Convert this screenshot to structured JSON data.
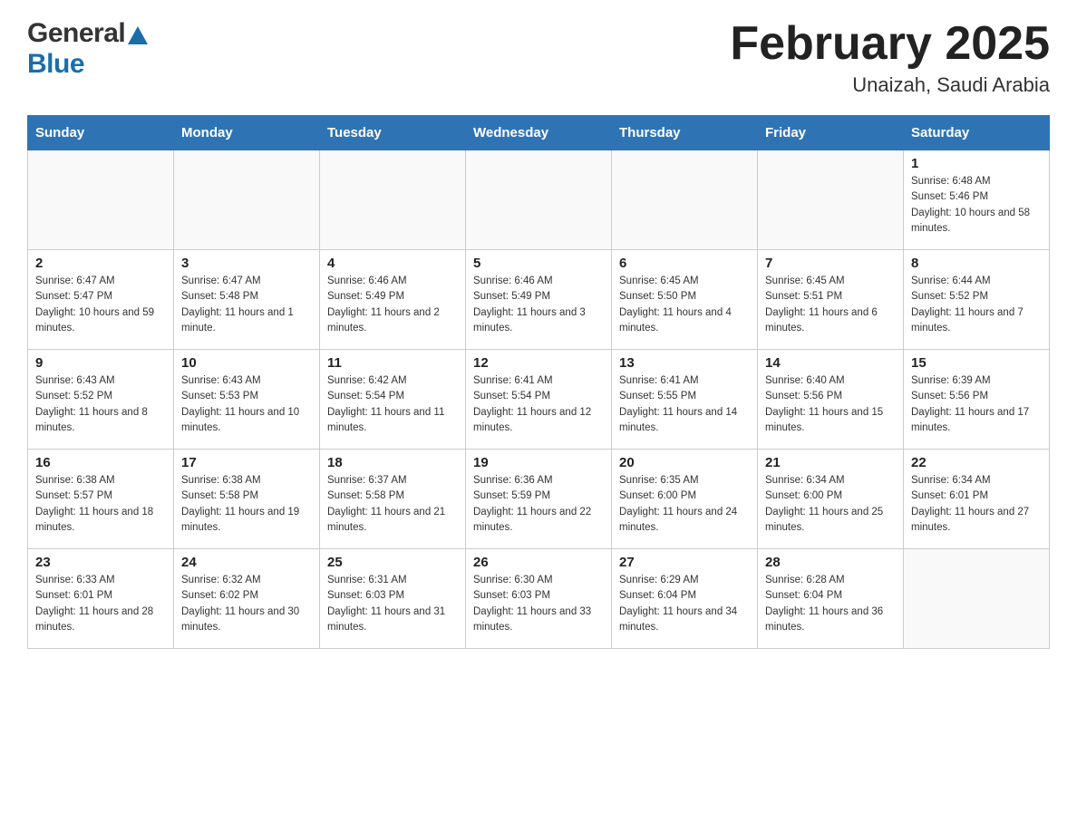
{
  "header": {
    "title": "February 2025",
    "subtitle": "Unaizah, Saudi Arabia",
    "logo_general": "General",
    "logo_blue": "Blue"
  },
  "days_of_week": [
    "Sunday",
    "Monday",
    "Tuesday",
    "Wednesday",
    "Thursday",
    "Friday",
    "Saturday"
  ],
  "weeks": [
    [
      {
        "day": "",
        "sunrise": "",
        "sunset": "",
        "daylight": "",
        "empty": true
      },
      {
        "day": "",
        "sunrise": "",
        "sunset": "",
        "daylight": "",
        "empty": true
      },
      {
        "day": "",
        "sunrise": "",
        "sunset": "",
        "daylight": "",
        "empty": true
      },
      {
        "day": "",
        "sunrise": "",
        "sunset": "",
        "daylight": "",
        "empty": true
      },
      {
        "day": "",
        "sunrise": "",
        "sunset": "",
        "daylight": "",
        "empty": true
      },
      {
        "day": "",
        "sunrise": "",
        "sunset": "",
        "daylight": "",
        "empty": true
      },
      {
        "day": "1",
        "sunrise": "Sunrise: 6:48 AM",
        "sunset": "Sunset: 5:46 PM",
        "daylight": "Daylight: 10 hours and 58 minutes.",
        "empty": false
      }
    ],
    [
      {
        "day": "2",
        "sunrise": "Sunrise: 6:47 AM",
        "sunset": "Sunset: 5:47 PM",
        "daylight": "Daylight: 10 hours and 59 minutes.",
        "empty": false
      },
      {
        "day": "3",
        "sunrise": "Sunrise: 6:47 AM",
        "sunset": "Sunset: 5:48 PM",
        "daylight": "Daylight: 11 hours and 1 minute.",
        "empty": false
      },
      {
        "day": "4",
        "sunrise": "Sunrise: 6:46 AM",
        "sunset": "Sunset: 5:49 PM",
        "daylight": "Daylight: 11 hours and 2 minutes.",
        "empty": false
      },
      {
        "day": "5",
        "sunrise": "Sunrise: 6:46 AM",
        "sunset": "Sunset: 5:49 PM",
        "daylight": "Daylight: 11 hours and 3 minutes.",
        "empty": false
      },
      {
        "day": "6",
        "sunrise": "Sunrise: 6:45 AM",
        "sunset": "Sunset: 5:50 PM",
        "daylight": "Daylight: 11 hours and 4 minutes.",
        "empty": false
      },
      {
        "day": "7",
        "sunrise": "Sunrise: 6:45 AM",
        "sunset": "Sunset: 5:51 PM",
        "daylight": "Daylight: 11 hours and 6 minutes.",
        "empty": false
      },
      {
        "day": "8",
        "sunrise": "Sunrise: 6:44 AM",
        "sunset": "Sunset: 5:52 PM",
        "daylight": "Daylight: 11 hours and 7 minutes.",
        "empty": false
      }
    ],
    [
      {
        "day": "9",
        "sunrise": "Sunrise: 6:43 AM",
        "sunset": "Sunset: 5:52 PM",
        "daylight": "Daylight: 11 hours and 8 minutes.",
        "empty": false
      },
      {
        "day": "10",
        "sunrise": "Sunrise: 6:43 AM",
        "sunset": "Sunset: 5:53 PM",
        "daylight": "Daylight: 11 hours and 10 minutes.",
        "empty": false
      },
      {
        "day": "11",
        "sunrise": "Sunrise: 6:42 AM",
        "sunset": "Sunset: 5:54 PM",
        "daylight": "Daylight: 11 hours and 11 minutes.",
        "empty": false
      },
      {
        "day": "12",
        "sunrise": "Sunrise: 6:41 AM",
        "sunset": "Sunset: 5:54 PM",
        "daylight": "Daylight: 11 hours and 12 minutes.",
        "empty": false
      },
      {
        "day": "13",
        "sunrise": "Sunrise: 6:41 AM",
        "sunset": "Sunset: 5:55 PM",
        "daylight": "Daylight: 11 hours and 14 minutes.",
        "empty": false
      },
      {
        "day": "14",
        "sunrise": "Sunrise: 6:40 AM",
        "sunset": "Sunset: 5:56 PM",
        "daylight": "Daylight: 11 hours and 15 minutes.",
        "empty": false
      },
      {
        "day": "15",
        "sunrise": "Sunrise: 6:39 AM",
        "sunset": "Sunset: 5:56 PM",
        "daylight": "Daylight: 11 hours and 17 minutes.",
        "empty": false
      }
    ],
    [
      {
        "day": "16",
        "sunrise": "Sunrise: 6:38 AM",
        "sunset": "Sunset: 5:57 PM",
        "daylight": "Daylight: 11 hours and 18 minutes.",
        "empty": false
      },
      {
        "day": "17",
        "sunrise": "Sunrise: 6:38 AM",
        "sunset": "Sunset: 5:58 PM",
        "daylight": "Daylight: 11 hours and 19 minutes.",
        "empty": false
      },
      {
        "day": "18",
        "sunrise": "Sunrise: 6:37 AM",
        "sunset": "Sunset: 5:58 PM",
        "daylight": "Daylight: 11 hours and 21 minutes.",
        "empty": false
      },
      {
        "day": "19",
        "sunrise": "Sunrise: 6:36 AM",
        "sunset": "Sunset: 5:59 PM",
        "daylight": "Daylight: 11 hours and 22 minutes.",
        "empty": false
      },
      {
        "day": "20",
        "sunrise": "Sunrise: 6:35 AM",
        "sunset": "Sunset: 6:00 PM",
        "daylight": "Daylight: 11 hours and 24 minutes.",
        "empty": false
      },
      {
        "day": "21",
        "sunrise": "Sunrise: 6:34 AM",
        "sunset": "Sunset: 6:00 PM",
        "daylight": "Daylight: 11 hours and 25 minutes.",
        "empty": false
      },
      {
        "day": "22",
        "sunrise": "Sunrise: 6:34 AM",
        "sunset": "Sunset: 6:01 PM",
        "daylight": "Daylight: 11 hours and 27 minutes.",
        "empty": false
      }
    ],
    [
      {
        "day": "23",
        "sunrise": "Sunrise: 6:33 AM",
        "sunset": "Sunset: 6:01 PM",
        "daylight": "Daylight: 11 hours and 28 minutes.",
        "empty": false
      },
      {
        "day": "24",
        "sunrise": "Sunrise: 6:32 AM",
        "sunset": "Sunset: 6:02 PM",
        "daylight": "Daylight: 11 hours and 30 minutes.",
        "empty": false
      },
      {
        "day": "25",
        "sunrise": "Sunrise: 6:31 AM",
        "sunset": "Sunset: 6:03 PM",
        "daylight": "Daylight: 11 hours and 31 minutes.",
        "empty": false
      },
      {
        "day": "26",
        "sunrise": "Sunrise: 6:30 AM",
        "sunset": "Sunset: 6:03 PM",
        "daylight": "Daylight: 11 hours and 33 minutes.",
        "empty": false
      },
      {
        "day": "27",
        "sunrise": "Sunrise: 6:29 AM",
        "sunset": "Sunset: 6:04 PM",
        "daylight": "Daylight: 11 hours and 34 minutes.",
        "empty": false
      },
      {
        "day": "28",
        "sunrise": "Sunrise: 6:28 AM",
        "sunset": "Sunset: 6:04 PM",
        "daylight": "Daylight: 11 hours and 36 minutes.",
        "empty": false
      },
      {
        "day": "",
        "sunrise": "",
        "sunset": "",
        "daylight": "",
        "empty": true
      }
    ]
  ]
}
